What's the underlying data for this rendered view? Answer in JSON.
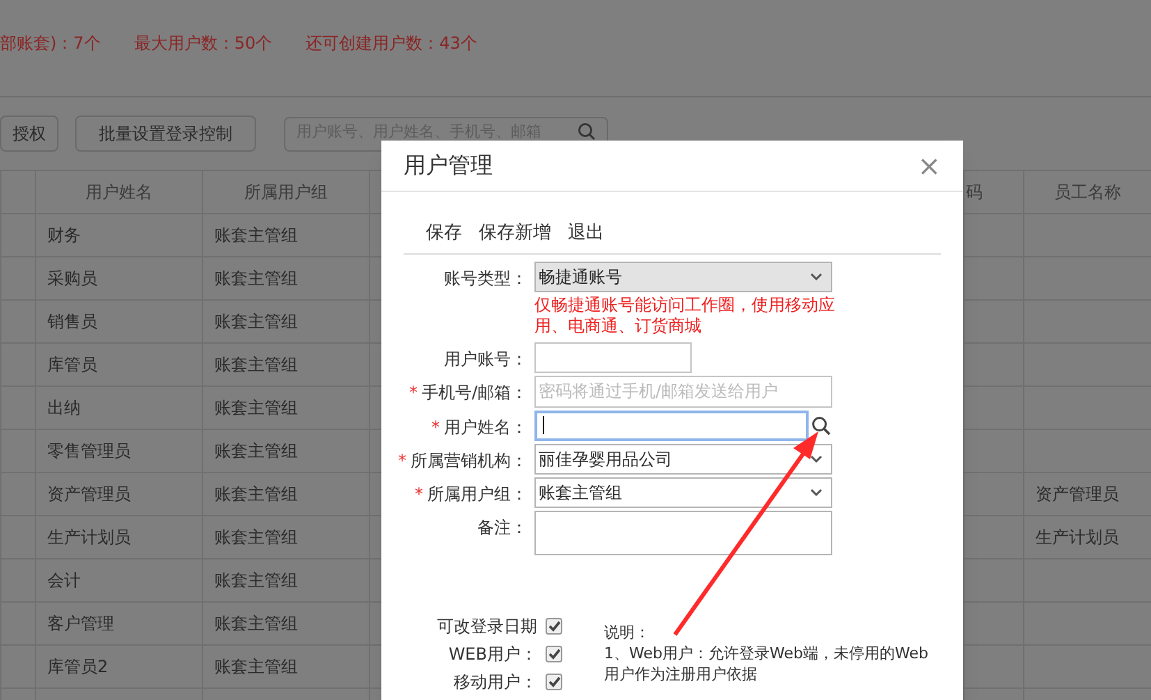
{
  "stats": [
    "部账套)：7个",
    "最大用户数：50个",
    "还可创建用户数：43个"
  ],
  "toolbar": {
    "buttons": [
      "授权",
      "批量设置登录控制"
    ],
    "search": {
      "placeholder": "用户账号、用户姓名、手机号、邮箱"
    }
  },
  "table": {
    "columns": [
      "用户姓名",
      "所属用户组",
      "码",
      "员工名称"
    ],
    "rows": [
      {
        "name": "财务",
        "group": "账套主管组",
        "staff": ""
      },
      {
        "name": "采购员",
        "group": "账套主管组",
        "staff": ""
      },
      {
        "name": "销售员",
        "group": "账套主管组",
        "staff": ""
      },
      {
        "name": "库管员",
        "group": "账套主管组",
        "staff": ""
      },
      {
        "name": "出纳",
        "group": "账套主管组",
        "staff": ""
      },
      {
        "name": "零售管理员",
        "group": "账套主管组",
        "staff": ""
      },
      {
        "name": "资产管理员",
        "group": "账套主管组",
        "staff": "资产管理员"
      },
      {
        "name": "生产计划员",
        "group": "账套主管组",
        "staff": "生产计划员"
      },
      {
        "name": "会计",
        "group": "账套主管组",
        "staff": ""
      },
      {
        "name": "客户管理",
        "group": "账套主管组",
        "staff": ""
      },
      {
        "name": "库管员2",
        "group": "账套主管组",
        "staff": ""
      }
    ]
  },
  "dialog": {
    "title": "用户管理",
    "close": "×",
    "actions": [
      "保存",
      "保存新增",
      "退出"
    ],
    "fields": [
      {
        "kind": "select",
        "label": "账号类型：",
        "value": "畅捷通账号",
        "disabled": true,
        "note": "仅畅捷通账号能访问工作圈，使用移动应用、电商通、订货商城"
      },
      {
        "kind": "short",
        "label": "用户账号："
      },
      {
        "kind": "text",
        "marker": "*",
        "label": "手机号/邮箱：",
        "placeholder": "密码将通过手机/邮箱发送给用户"
      },
      {
        "kind": "search",
        "marker": "*",
        "label": "用户姓名：",
        "focused": true
      },
      {
        "kind": "select",
        "marker": "*",
        "label": "所属营销机构：",
        "value": "丽佳孕婴用品公司",
        "disabled": false
      },
      {
        "kind": "select",
        "marker": "*",
        "label": "所属用户组：",
        "value": "账套主管组",
        "disabled": false
      },
      {
        "kind": "textarea",
        "label": "备注："
      }
    ],
    "checkboxes": [
      {
        "label": "可改登录日期",
        "checked": true
      },
      {
        "label": "WEB用户：",
        "checked": true
      },
      {
        "label": "移动用户：",
        "checked": true
      }
    ],
    "notes": [
      "说明：",
      "1、Web用户：允许登录Web端，未停用的Web用户作为注册用户依据"
    ]
  }
}
